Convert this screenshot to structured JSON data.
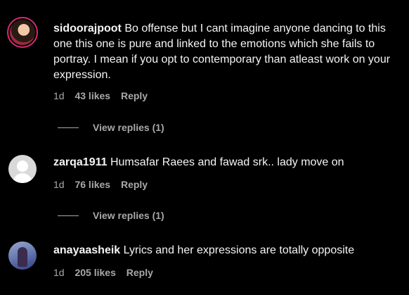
{
  "comments": [
    {
      "username": "sidoorajpoot",
      "text": "Bo offense but I cant imagine anyone dancing to this one this one is pure and linked to the emotions which she fails to portray. I mean if you opt to contemporary than atleast work on your expression.",
      "time": "1d",
      "likes": "43 likes",
      "reply": "Reply",
      "view_replies": "View replies (1)"
    },
    {
      "username": "zarqa1911",
      "text": "Humsafar Raees and fawad srk.. lady move on",
      "time": "1d",
      "likes": "76 likes",
      "reply": "Reply",
      "view_replies": "View replies (1)"
    },
    {
      "username": "anayaasheik",
      "text": "Lyrics and her expressions are totally opposite",
      "time": "1d",
      "likes": "205 likes",
      "reply": "Reply"
    }
  ]
}
